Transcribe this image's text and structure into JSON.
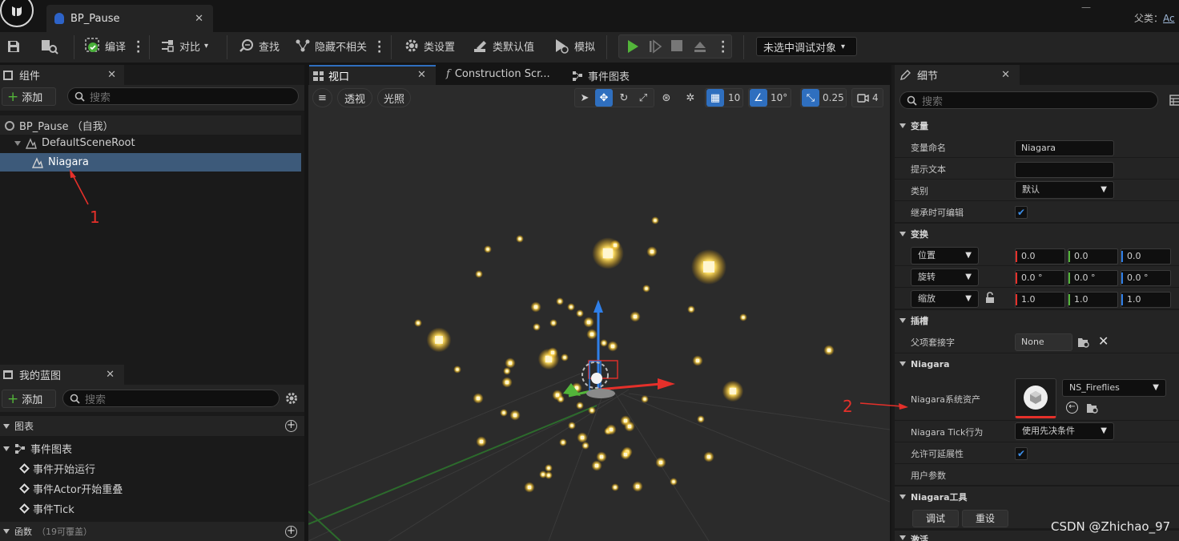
{
  "tab": {
    "title": "BP_Pause"
  },
  "parent_class": {
    "label": "父类：",
    "value": "Ac"
  },
  "toolbar": {
    "compile": "编译",
    "diff": "对比",
    "find": "查找",
    "hide_unrelated": "隐藏不相关",
    "class_settings": "类设置",
    "class_defaults": "类默认值",
    "simulate": "模拟",
    "debug_object": "未选中调试对象"
  },
  "components_panel": {
    "title": "组件",
    "add": "添加",
    "search_placeholder": "搜索",
    "tree": [
      {
        "label": "BP_Pause （自我）"
      },
      {
        "label": "DefaultSceneRoot"
      },
      {
        "label": "Niagara"
      }
    ]
  },
  "annotations": {
    "one": "1",
    "two": "2"
  },
  "my_blueprint": {
    "title": "我的蓝图",
    "add": "添加",
    "search_placeholder": "搜索",
    "graphs_header": "图表",
    "event_graph": "事件图表",
    "events": [
      "事件开始运行",
      "事件Actor开始重叠",
      "事件Tick"
    ],
    "functions_header": "函数",
    "functions_note": "（19可覆盖）"
  },
  "editor_tabs": {
    "viewport": "视口",
    "construction": "Construction Scr...",
    "event_graph": "事件图表"
  },
  "viewport": {
    "perspective": "透视",
    "lit": "光照",
    "grid_snap": "10",
    "rot_snap": "10°",
    "scale_snap": "0.25",
    "cam_speed": "4"
  },
  "details": {
    "title": "细节",
    "search_placeholder": "搜索",
    "variable_section": "变量",
    "var_name_label": "变量命名",
    "var_name_value": "Niagara",
    "tooltip_label": "提示文本",
    "tooltip_value": "",
    "category_label": "类别",
    "category_value": "默认",
    "editable_label": "继承时可编辑",
    "transform_section": "变换",
    "location": "位置",
    "rotation": "旋转",
    "scale": "缩放",
    "loc": [
      "0.0",
      "0.0",
      "0.0"
    ],
    "rot": [
      "0.0 °",
      "0.0 °",
      "0.0 °"
    ],
    "scl": [
      "1.0",
      "1.0",
      "1.0"
    ],
    "socket_section": "插槽",
    "parent_socket_label": "父项套接字",
    "parent_socket_value": "None",
    "niagara_section": "Niagara",
    "niagara_asset_label": "Niagara系统资产",
    "niagara_asset_value": "NS_Fireflies",
    "tick_label": "Niagara Tick行为",
    "tick_value": "使用先决条件",
    "scalability_label": "允许可延展性",
    "user_params": "用户参数",
    "utilities_section": "Niagara工具",
    "debug_btn": "调试",
    "reset_btn": "重设",
    "activation_section": "激活"
  },
  "watermark": "CSDN @Zhichao_97",
  "colors": {
    "accent": "#2f6fbf",
    "play": "#53b53a",
    "glow": "#ffc233",
    "selection": "#3d5a7a"
  }
}
